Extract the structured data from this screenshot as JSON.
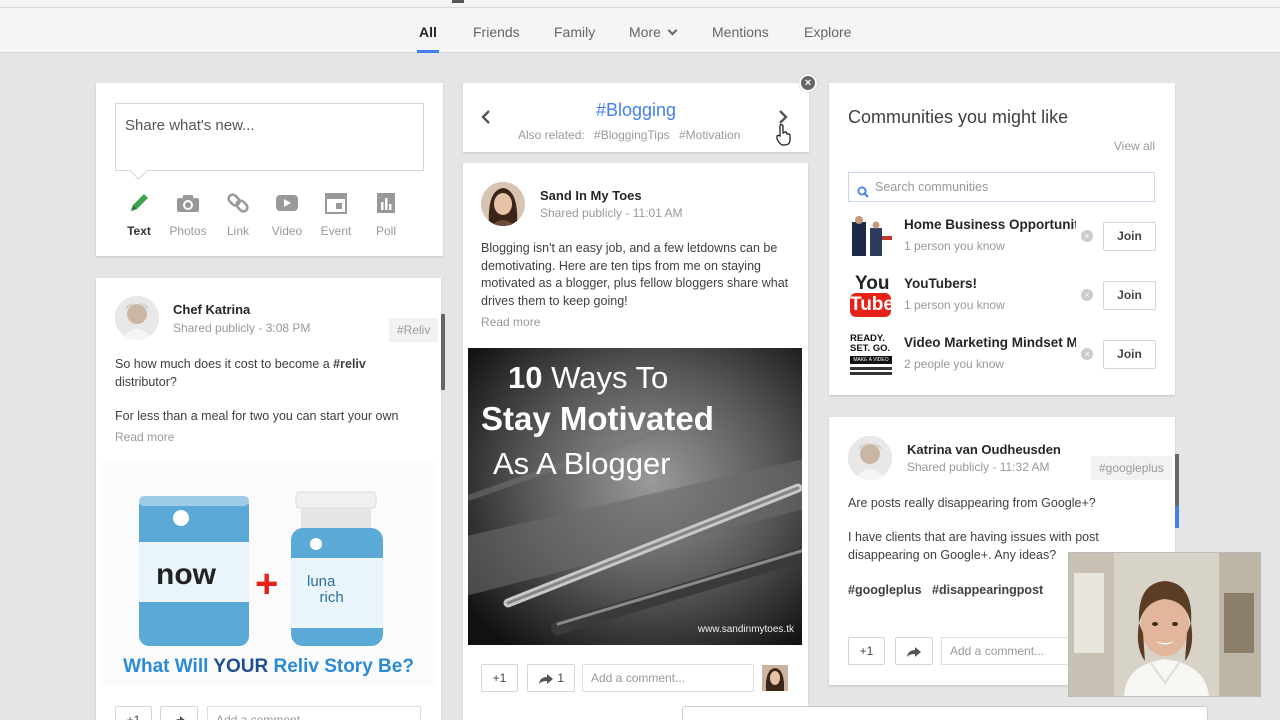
{
  "nav": {
    "tabs": [
      {
        "label": "All"
      },
      {
        "label": "Friends"
      },
      {
        "label": "Family"
      },
      {
        "label": "More"
      },
      {
        "label": "Mentions"
      },
      {
        "label": "Explore"
      }
    ]
  },
  "share": {
    "placeholder": "Share what's new...",
    "options": [
      {
        "label": "Text",
        "icon": "pencil-icon"
      },
      {
        "label": "Photos",
        "icon": "camera-icon"
      },
      {
        "label": "Link",
        "icon": "link-icon"
      },
      {
        "label": "Video",
        "icon": "video-icon"
      },
      {
        "label": "Event",
        "icon": "calendar-icon"
      },
      {
        "label": "Poll",
        "icon": "poll-icon"
      }
    ]
  },
  "post1": {
    "author": "Chef Katrina",
    "visibility": "Shared publicly",
    "time": "3:08 PM",
    "hashtag": "#Reliv",
    "text_before": "So how much does it cost to become a ",
    "text_tag": "#reliv",
    "text_after": " distributor?",
    "text2": "For less than a meal for two you can start your own",
    "read_more": "Read more",
    "image_word": "now",
    "image_plus": "+",
    "image_brand1": "luna",
    "image_brand2": "rich",
    "image_caption_a": "What Will ",
    "image_caption_b": "YOUR",
    "image_caption_c": " Reliv Story Be?",
    "plus_one": "+1",
    "comment_placeholder": "Add a comment..."
  },
  "blogging": {
    "title": "#Blogging",
    "related_label": "Also related:",
    "related": [
      "#BloggingTips",
      "#Motivation"
    ]
  },
  "post2": {
    "author": "Sand In My Toes",
    "visibility": "Shared publicly",
    "time": "11:01 AM",
    "text": "Blogging isn't an easy job, and a few letdowns can be demotivating. Here are ten tips from me on staying motivated as a blogger, plus fellow bloggers share what drives them to keep going!",
    "read_more": "Read more",
    "image_line1_num": "10",
    "image_line1_rest": " Ways To",
    "image_line2": "Stay Motivated",
    "image_line3": "As A Blogger",
    "image_url": "www.sandinmytoes.tk",
    "plus_one": "+1",
    "share_count": "1",
    "comment_placeholder": "Add a comment..."
  },
  "communities": {
    "title": "Communities you might like",
    "view_all": "View all",
    "search_placeholder": "Search communities",
    "items": [
      {
        "name": "Home Business Opportuniti",
        "sub": "1 person you know",
        "join": "Join"
      },
      {
        "name": "YouTubers!",
        "sub": "1 person you know",
        "join": "Join"
      },
      {
        "name": "Video Marketing Mindset M",
        "sub": "2 people you know",
        "join": "Join"
      }
    ],
    "youtube_you": "You",
    "youtube_tube": "Tube",
    "ready_text": "READY. SET. GO.",
    "ready_sub": "MAKE A VIDEO"
  },
  "post3": {
    "author": "Katrina van Oudheusden",
    "visibility": "Shared publicly",
    "time": "11:32 AM",
    "hashtag": "#googleplus",
    "text1": "Are posts really disappearing from Google+?",
    "text2": "I have clients that are having issues with post disappearing on Google+. Any ideas?",
    "tags": [
      "#googleplus",
      "#disappearingpost"
    ],
    "plus_one": "+1",
    "comment_placeholder": "Add a comment..."
  },
  "colors": {
    "accent": "#427fed",
    "background": "#e5e5e5",
    "red": "#e62117"
  }
}
